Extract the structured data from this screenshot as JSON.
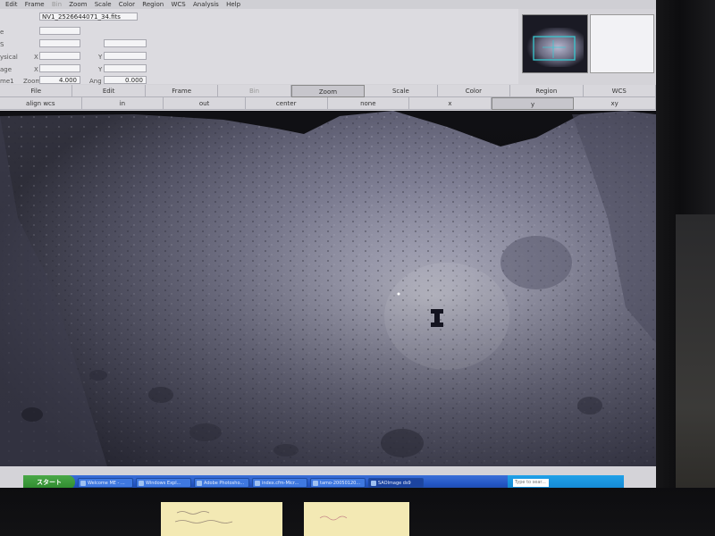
{
  "menu": {
    "items": [
      "Edit",
      "Frame",
      "Bin",
      "Zoom",
      "Scale",
      "Color",
      "Region",
      "WCS",
      "Analysis",
      "Help"
    ]
  },
  "info": {
    "file_value": "NV1_2526644071_34.fits",
    "zoom_label": "Zoom",
    "zoom_value": "4.000",
    "angle_label": "Ang",
    "angle_value": "0.000",
    "x_label": "X",
    "y_label": "Y",
    "labels": [
      "e",
      "S",
      "ysical",
      "age",
      "me1"
    ]
  },
  "buttons_main": [
    "File",
    "Edit",
    "Frame",
    "Bin",
    "Zoom",
    "Scale",
    "Color",
    "Region",
    "WCS"
  ],
  "buttons_sub": [
    "align wcs",
    "in",
    "out",
    "center",
    "none",
    "x",
    "y",
    "xy"
  ],
  "taskbar": {
    "start_label": "スタート",
    "items": [
      "Welcome ME - ...",
      "Windows Expl...",
      "Adobe Photosho...",
      "index.cfm-Micr...",
      "tamo-20050120...",
      "SAOImage ds9"
    ],
    "search_placeholder": "Type to sear..."
  },
  "colors": {
    "taskbar": "#2456c4",
    "start_button": "#2e8a2e",
    "pan_box": "#38c8d0"
  }
}
